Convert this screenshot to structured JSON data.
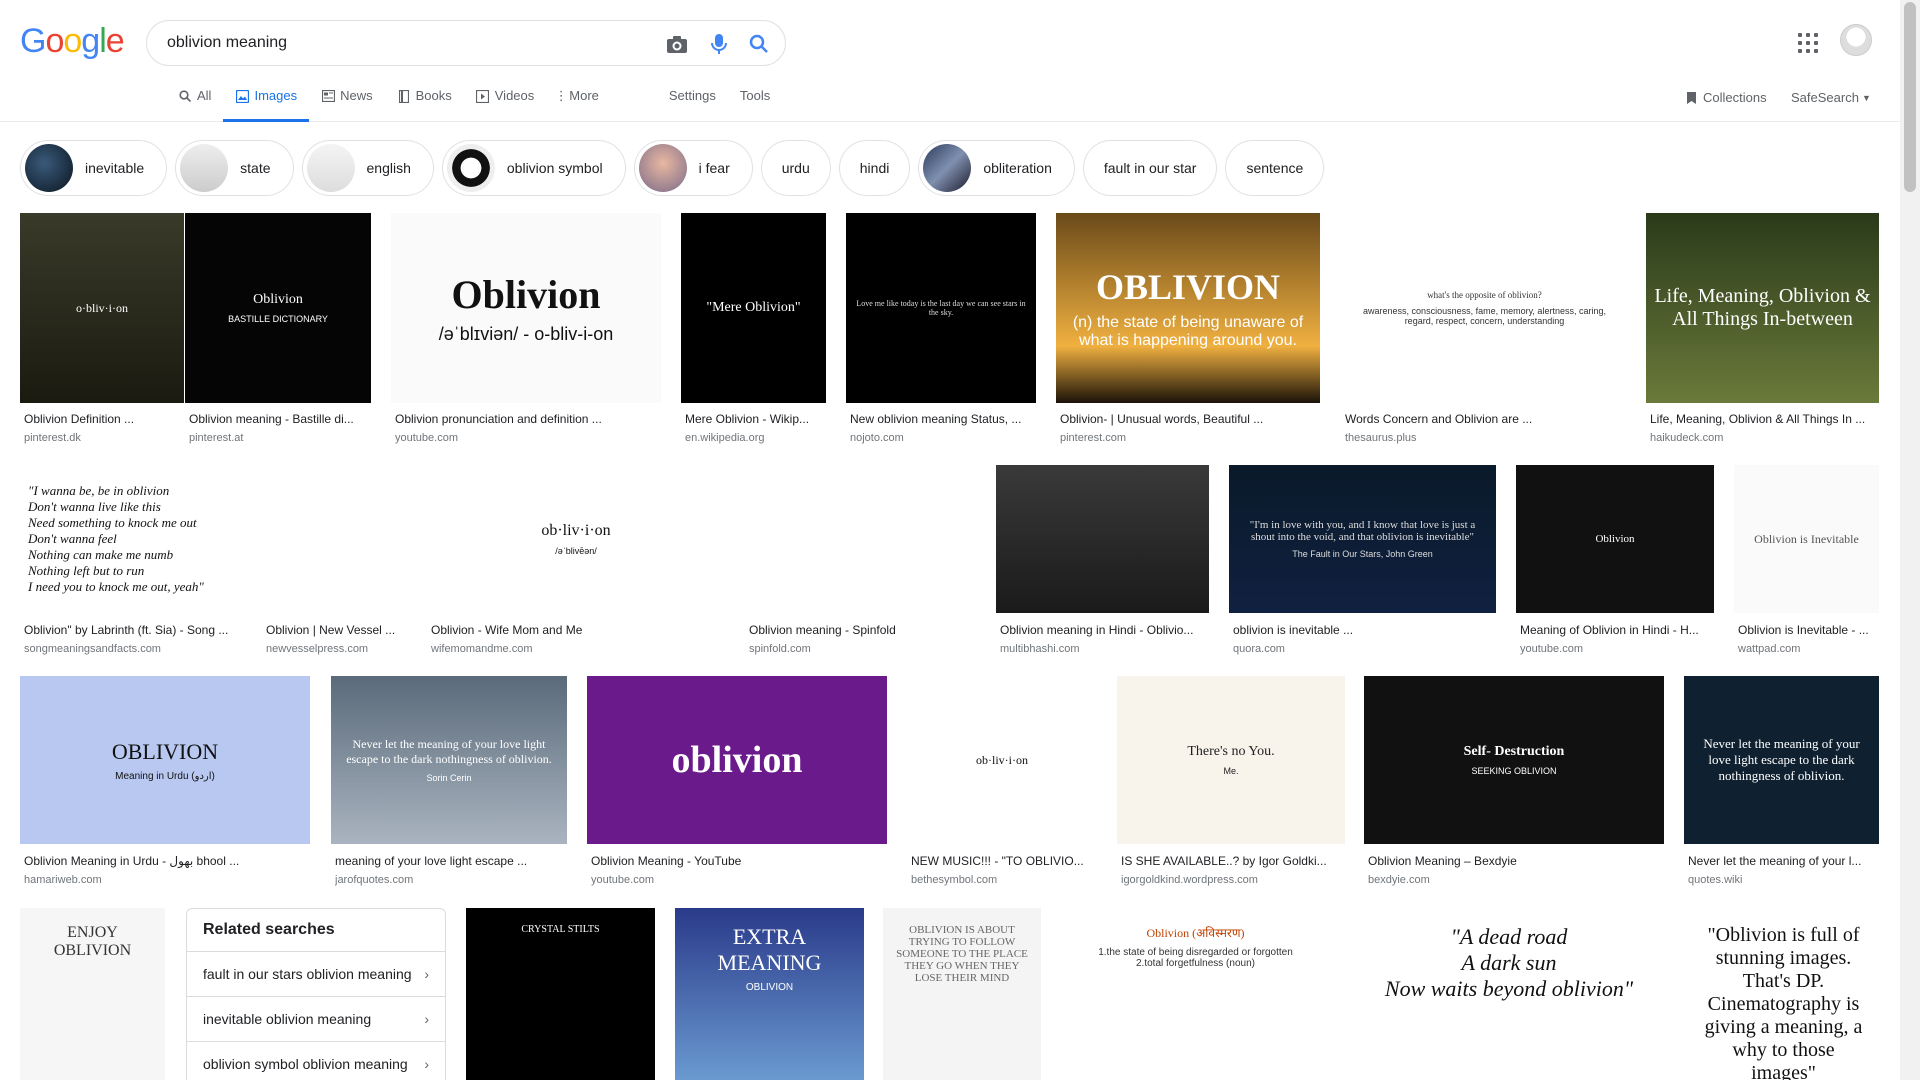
{
  "search": {
    "query": "oblivion meaning"
  },
  "logo": {
    "letters": [
      "G",
      "o",
      "o",
      "g",
      "l",
      "e"
    ],
    "colors": [
      "#4285f4",
      "#ea4335",
      "#fbbc05",
      "#4285f4",
      "#34a853",
      "#ea4335"
    ]
  },
  "tabs": [
    {
      "label": "All",
      "icon": "search-icon"
    },
    {
      "label": "Images",
      "icon": "image-icon",
      "active": true
    },
    {
      "label": "News",
      "icon": "news-icon"
    },
    {
      "label": "Books",
      "icon": "book-icon"
    },
    {
      "label": "Videos",
      "icon": "video-icon"
    },
    {
      "label": "More",
      "icon": "more-vert-icon"
    }
  ],
  "tools": {
    "settings": "Settings",
    "tools": "Tools",
    "collections": "Collections",
    "safesearch": "SafeSearch"
  },
  "colors": {
    "accent": "#1a73e8",
    "text_secondary": "#5f6368",
    "url": "#70757a"
  },
  "chips": [
    {
      "label": "inevitable",
      "has_thumb": true
    },
    {
      "label": "state",
      "has_thumb": true
    },
    {
      "label": "english",
      "has_thumb": true
    },
    {
      "label": "oblivion symbol",
      "has_thumb": true
    },
    {
      "label": "i fear",
      "has_thumb": true
    },
    {
      "label": "urdu",
      "has_thumb": false
    },
    {
      "label": "hindi",
      "has_thumb": false
    },
    {
      "label": "obliteration",
      "has_thumb": true
    },
    {
      "label": "fault in our star",
      "has_thumb": false
    },
    {
      "label": "sentence",
      "has_thumb": false
    }
  ],
  "results": [
    {
      "caption": "Oblivion Definition ...",
      "source": "pinterest.dk",
      "img_text": "o·bliv·i·on"
    },
    {
      "caption": "Oblivion meaning - Bastille di...",
      "source": "pinterest.at",
      "img_text": "Oblivion",
      "img_text2": "BASTILLE DICTIONARY"
    },
    {
      "caption": "Oblivion pronunciation and definition ...",
      "source": "youtube.com",
      "img_text": "Oblivion",
      "img_text2": "/əˈblɪviən/ - o-bliv-i-on"
    },
    {
      "caption": "Mere Oblivion - Wikip...",
      "source": "en.wikipedia.org",
      "img_text": "\"Mere Oblivion\""
    },
    {
      "caption": "New oblivion meaning Status, ...",
      "source": "nojoto.com",
      "img_text": "Love me like today is the last day we can see stars in the sky."
    },
    {
      "caption": "Oblivion- | Unusual words, Beautiful ...",
      "source": "pinterest.com",
      "img_text": "OBLIVION",
      "img_text2": "(n) the state of being unaware of what is happening around you."
    },
    {
      "caption": "Words Concern and Oblivion are ...",
      "source": "thesaurus.plus",
      "img_text": "what's the opposite of oblivion?",
      "img_text2": "awareness, consciousness, fame, memory, alertness, caring, regard, respect, concern, understanding"
    },
    {
      "caption": "Life, Meaning, Oblivion & All Things In ...",
      "source": "haikudeck.com",
      "img_text": "Life, Meaning, Oblivion & All Things In-between"
    },
    {
      "caption": "Oblivion\" by Labrinth (ft. Sia) - Song ...",
      "source": "songmeaningsandfacts.com",
      "img_text": "\"I wanna be, be in oblivion\nDon't wanna live like this\nNeed something to knock me out\nDon't wanna feel\nNothing can make me numb\nNothing left but to run\nI need you to knock me out, yeah\""
    },
    {
      "caption": "Oblivion | New Vessel ...",
      "source": "newvesselpress.com",
      "img_text": "OBLIVION"
    },
    {
      "caption": "Oblivion - Wife Mom and Me",
      "source": "wifemomandme.com",
      "img_text": "ob·liv·i·on",
      "img_text2": "/əˈblivēən/"
    },
    {
      "caption": "Oblivion meaning - Spinfold",
      "source": "spinfold.com",
      "img_text": ""
    },
    {
      "caption": "Oblivion meaning in Hindi - Oblivio...",
      "source": "multibhashi.com",
      "img_text": ""
    },
    {
      "caption": "oblivion is inevitable ...",
      "source": "quora.com",
      "img_text": "\"I'm in love with you, and I know that love is just a shout into the void, and that oblivion is inevitable\"",
      "img_text2": "The Fault in Our Stars, John Green"
    },
    {
      "caption": "Meaning of Oblivion in Hindi - H...",
      "source": "youtube.com",
      "img_text": "Oblivion"
    },
    {
      "caption": "Oblivion is Inevitable - ...",
      "source": "wattpad.com",
      "img_text": "Oblivion is Inevitable"
    },
    {
      "caption": "Oblivion Meaning in Urdu - بھول bhool ...",
      "source": "hamariweb.com",
      "img_text": "OBLIVION",
      "img_text2": "Meaning in Urdu (اردو)"
    },
    {
      "caption": "meaning of your love light escape ...",
      "source": "jarofquotes.com",
      "img_text": "Never let the meaning of your love light escape to the dark nothingness of oblivion.",
      "img_text2": "Sorin Cerin"
    },
    {
      "caption": "Oblivion Meaning - YouTube",
      "source": "youtube.com",
      "img_text": "oblivion"
    },
    {
      "caption": "NEW MUSIC!!! - \"TO OBLIVIO...",
      "source": "bethesymbol.com",
      "img_text": "ob·liv·i·on"
    },
    {
      "caption": "IS SHE AVAILABLE..? by Igor Goldki...",
      "source": "igorgoldkind.wordpress.com",
      "img_text": "There's no You.",
      "img_text2": "Me."
    },
    {
      "caption": "Oblivion Meaning – Bexdyie",
      "source": "bexdyie.com",
      "img_text": "Self- Destruction",
      "img_text2": "SEEKING OBLIVION"
    },
    {
      "caption": "Never let the meaning of your l...",
      "source": "quotes.wiki",
      "img_text": "Never let the meaning of your love light escape to the dark nothingness of oblivion."
    }
  ],
  "bottom_row": [
    {
      "img_text": "ENJOY OBLIVION"
    },
    {
      "img_text": "CRYSTAL STILTS"
    },
    {
      "img_text": "EXTRA MEANING",
      "img_text2": "OBLIVION"
    },
    {
      "img_text": "OBLIVION IS ABOUT TRYING TO FOLLOW SOMEONE TO THE PLACE THEY GO WHEN THEY LOSE THEIR MIND"
    },
    {
      "img_text": "Oblivion (अविस्मरण)",
      "img_text2": "1.the state of being disregarded or forgotten\n2.total forgetfulness (noun)"
    },
    {
      "img_text": "\"A dead road\nA dark sun\nNow waits beyond oblivion\""
    },
    {
      "img_text": "\"Oblivion is full of stunning images. That's DP. Cinematography is giving a meaning, a why to those images\""
    }
  ],
  "related": {
    "title": "Related searches",
    "items": [
      "fault in our stars oblivion meaning",
      "inevitable oblivion meaning",
      "oblivion symbol oblivion meaning"
    ]
  }
}
